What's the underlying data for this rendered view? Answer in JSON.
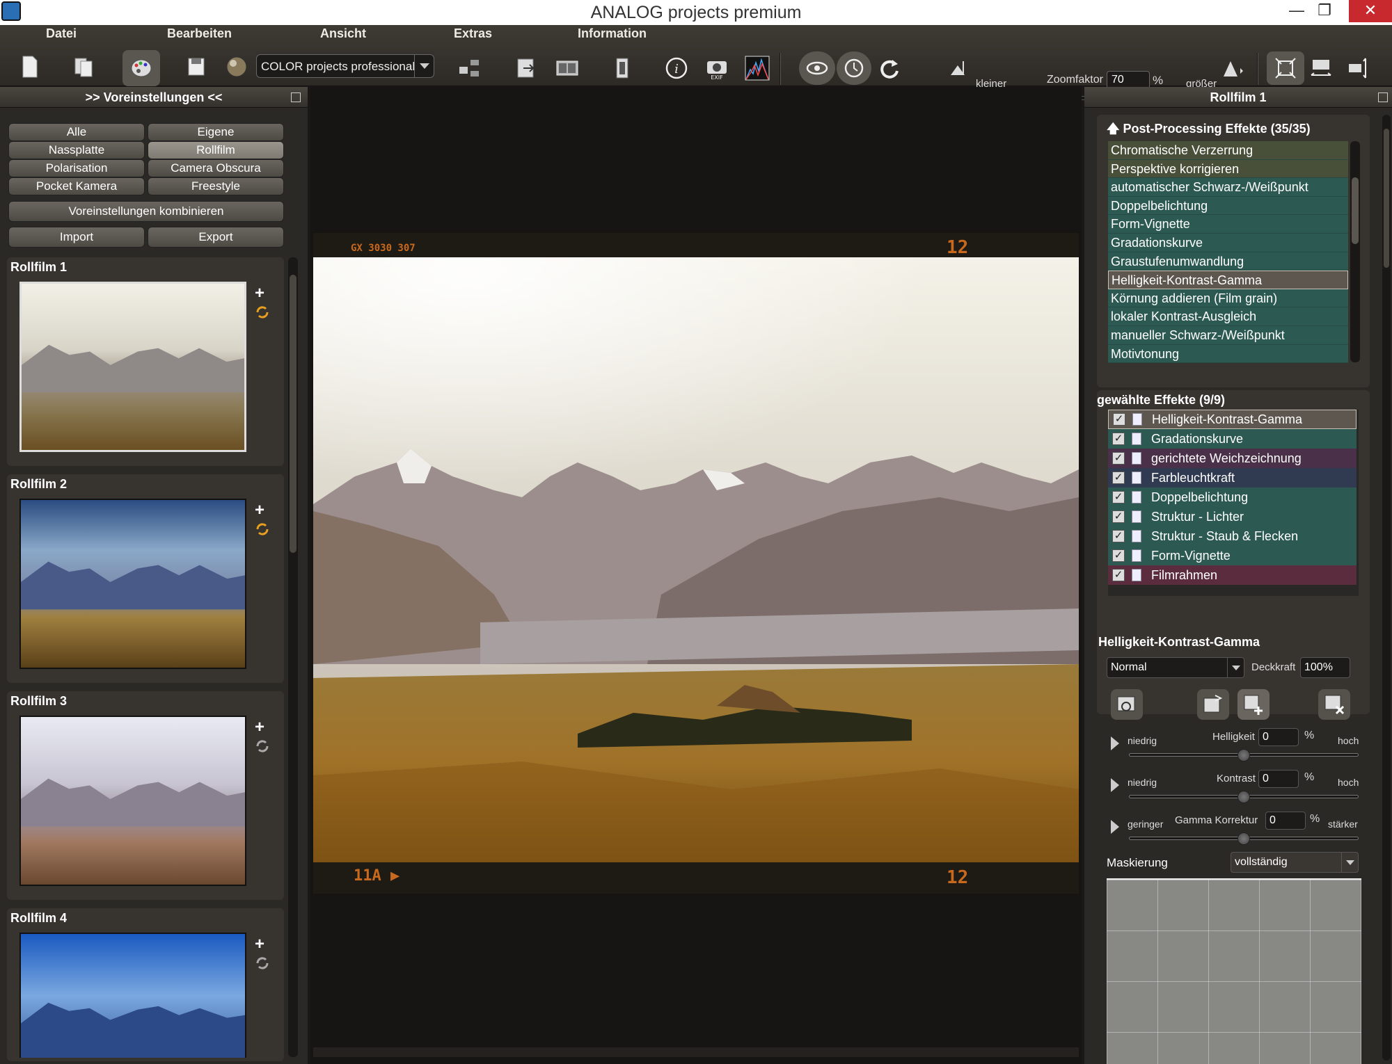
{
  "window": {
    "title": "ANALOG projects premium",
    "minimize": "—",
    "restore": "❐",
    "close": "✕"
  },
  "menu": [
    "Datei",
    "Bearbeiten",
    "Ansicht",
    "Extras",
    "Information"
  ],
  "toolbar": {
    "preset_select": "COLOR projects professional",
    "zoom_smaller": "kleiner",
    "zoom_label": "Zoomfaktor",
    "zoom_value": "70",
    "zoom_unit": "%",
    "zoom_bigger": "größer",
    "zoom_level": 0.1
  },
  "left_panel": {
    "title": ">> Voreinstellungen <<",
    "filters": [
      "Alle",
      "Eigene",
      "Nassplatte",
      "Rollfilm",
      "Polarisation",
      "Camera Obscura",
      "Pocket Kamera",
      "Freestyle"
    ],
    "selected_filter": "Rollfilm",
    "combine": "Voreinstellungen kombinieren",
    "import": "Import",
    "export": "Export",
    "presets": [
      {
        "name": "Rollfilm 1"
      },
      {
        "name": "Rollfilm 2"
      },
      {
        "name": "Rollfilm 3"
      },
      {
        "name": "Rollfilm 4"
      }
    ]
  },
  "photo": {
    "top_code": "GX 3030 307",
    "top_frame": "12",
    "bottom_code": "11A ▶",
    "bottom_frame": "12"
  },
  "right_panel": {
    "title": "Rollfilm 1",
    "post_header": "Post-Processing Effekte (35/35)",
    "post_effects": [
      "Chromatische Verzerrung",
      "Perspektive korrigieren",
      "automatischer Schwarz-/Weißpunkt",
      "Doppelbelichtung",
      "Form-Vignette",
      "Gradationskurve",
      "Graustufenumwandlung",
      "Helligkeit-Kontrast-Gamma",
      "Körnung addieren (Film grain)",
      "lokaler Kontrast-Ausgleich",
      "manueller Schwarz-/Weißpunkt",
      "Motivtonung"
    ],
    "selected_header": "gewählte Effekte (9/9)",
    "selected_effects": [
      {
        "name": "Helligkeit-Kontrast-Gamma",
        "color": "#5e5750"
      },
      {
        "name": "Gradationskurve",
        "color": "#2c5a53"
      },
      {
        "name": "gerichtete Weichzeichnung",
        "color": "#4a3048"
      },
      {
        "name": "Farbleuchtkraft",
        "color": "#303a50"
      },
      {
        "name": "Doppelbelichtung",
        "color": "#2c5a53"
      },
      {
        "name": "Struktur - Lichter",
        "color": "#2c5a53"
      },
      {
        "name": "Struktur - Staub & Flecken",
        "color": "#2c5a53"
      },
      {
        "name": "Form-Vignette",
        "color": "#2c5a53"
      },
      {
        "name": "Filmrahmen",
        "color": "#5a2c3e"
      }
    ],
    "check_mark": "✓",
    "effect_title": "Helligkeit-Kontrast-Gamma",
    "blend_mode": "Normal",
    "opacity_label": "Deckkraft",
    "opacity_value": "100%",
    "sliders": [
      {
        "low": "niedrig",
        "label": "Helligkeit",
        "value": "0",
        "unit": "%",
        "high": "hoch"
      },
      {
        "low": "niedrig",
        "label": "Kontrast",
        "value": "0",
        "unit": "%",
        "high": "hoch"
      },
      {
        "low": "geringer",
        "label": "Gamma Korrektur",
        "value": "0",
        "unit": "%",
        "high": "stärker"
      }
    ],
    "mask_label": "Maskierung",
    "mask_value": "vollständig"
  }
}
